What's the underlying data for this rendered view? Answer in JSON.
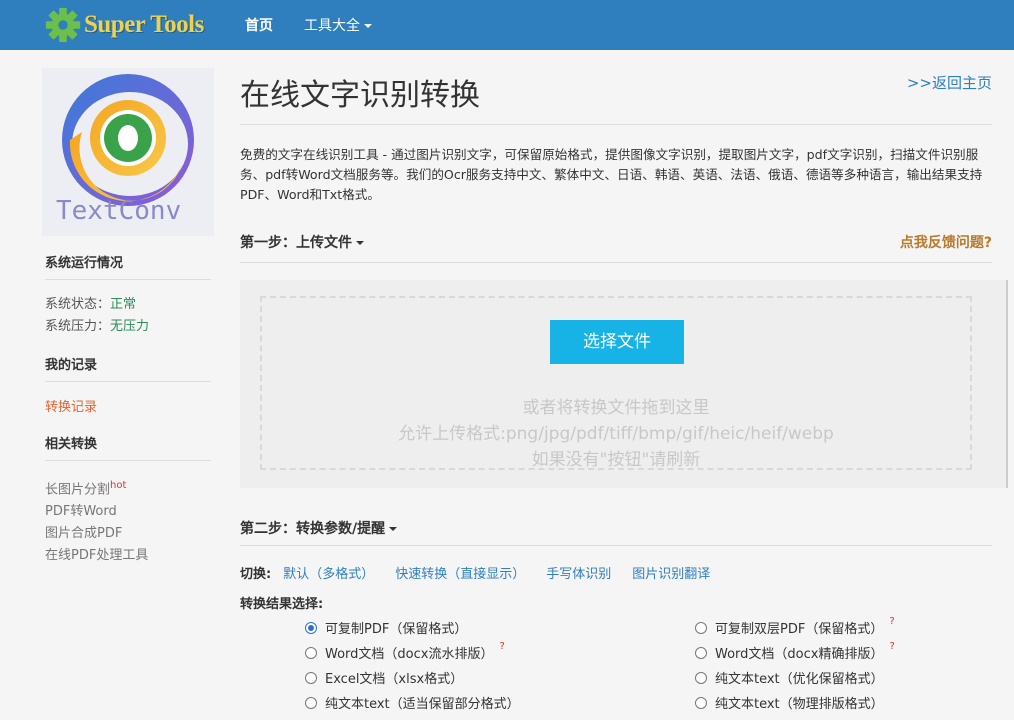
{
  "header": {
    "brand": "Super Tools",
    "nav_home": "首页",
    "nav_tools": "工具大全"
  },
  "sidebar": {
    "logo_text": "TextConv",
    "status_heading": "系统运行情况",
    "status_label": "系统状态：",
    "status_value": "正常",
    "load_label": "系统压力：",
    "load_value": "无压力",
    "records_heading": "我的记录",
    "records_link": "转换记录",
    "related_heading": "相关转换",
    "related": [
      {
        "label": "长图片分割",
        "badge": "hot"
      },
      {
        "label": "PDF转Word",
        "badge": ""
      },
      {
        "label": "图片合成PDF",
        "badge": ""
      },
      {
        "label": "在线PDF处理工具",
        "badge": ""
      }
    ]
  },
  "main": {
    "title": "在线文字识别转换",
    "back_link": ">>返回主页",
    "description": "免费的文字在线识别工具 - 通过图片识别文字，可保留原始格式，提供图像文字识别，提取图片文字，pdf文字识别，扫描文件识别服务、pdf转Word文档服务等。我们的Ocr服务支持中文、繁体中文、日语、韩语、英语、法语、俄语、德语等多种语言，输出结果支持PDF、Word和Txt格式。",
    "step1_label": "第一步：上传文件",
    "feedback_link": "点我反馈问题?",
    "choose_button": "选择文件",
    "drop_hint": "或者将转换文件拖到这里",
    "allowed_formats": "允许上传格式:png/jpg/pdf/tiff/bmp/gif/heic/heif/webp",
    "refresh_hint": "如果没有\"按钮\"请刷新",
    "step2_label": "第二步：转换参数/提醒",
    "switch_label": "切换:",
    "switch_options": [
      "默认（多格式）",
      "快速转换（直接显示）",
      "手写体识别",
      "图片识别翻译"
    ],
    "result_label": "转换结果选择:",
    "result_options": [
      {
        "label": "可复制PDF（保留格式）",
        "selected": true,
        "help": ""
      },
      {
        "label": "可复制双层PDF（保留格式）",
        "selected": false,
        "help": "?"
      },
      {
        "label": "Word文档（docx流水排版）",
        "selected": false,
        "help": "?"
      },
      {
        "label": "Word文档（docx精确排版）",
        "selected": false,
        "help": "?"
      },
      {
        "label": "Excel文档（xlsx格式）",
        "selected": false,
        "help": ""
      },
      {
        "label": "纯文本text（优化保留格式）",
        "selected": false,
        "help": ""
      },
      {
        "label": "纯文本text（适当保留部分格式）",
        "selected": false,
        "help": ""
      },
      {
        "label": "纯文本text（物理排版格式）",
        "selected": false,
        "help": ""
      }
    ]
  },
  "colors": {
    "header_bg": "#2f7fbf",
    "brand_text": "#f2d14a",
    "link": "#2f7fbf",
    "button": "#17b3e6",
    "status_ok": "#2e8b57",
    "record_link": "#e06432",
    "feedback": "#b97a2a"
  }
}
